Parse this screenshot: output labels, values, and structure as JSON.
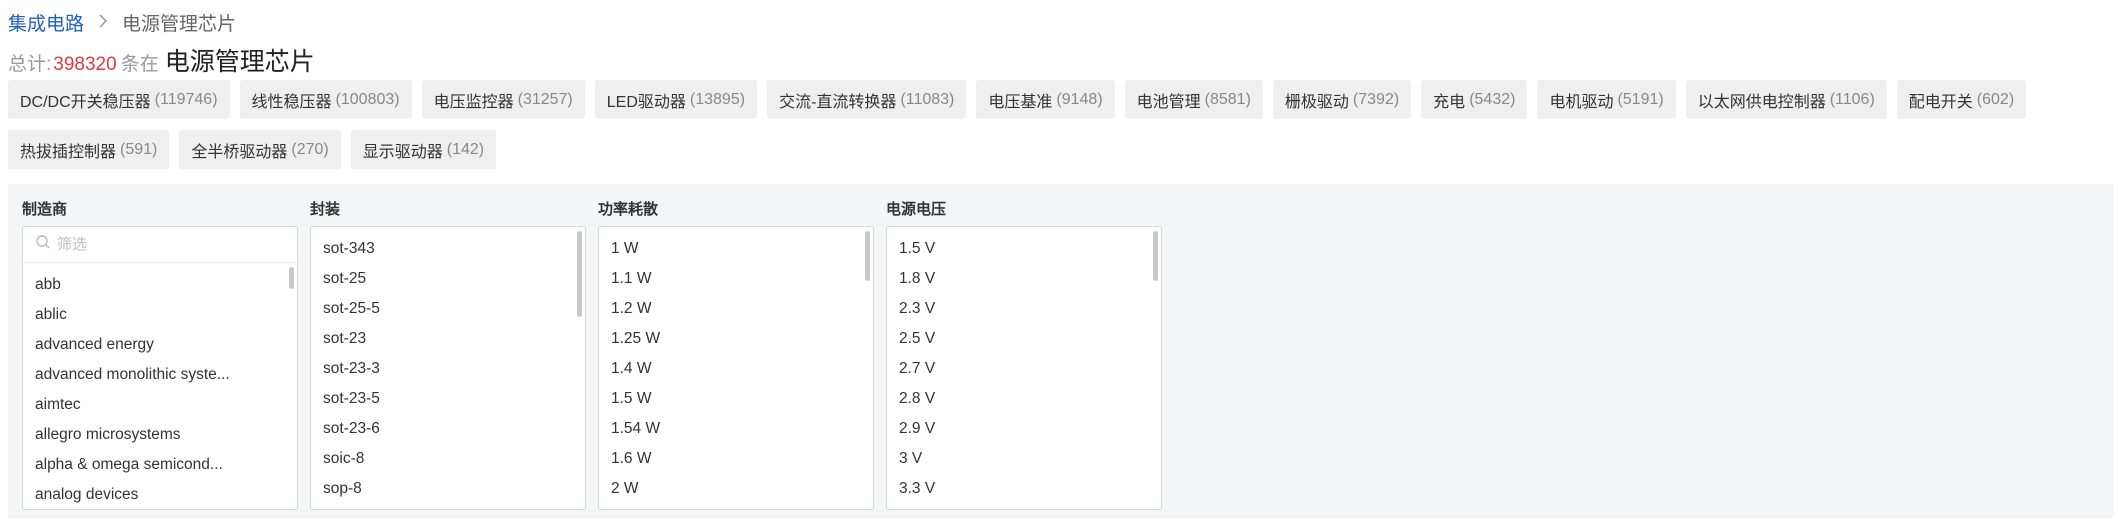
{
  "breadcrumb": {
    "root": "集成电路",
    "current": "电源管理芯片"
  },
  "total": {
    "prefix": "总计:",
    "count": "398320",
    "unit": "条在",
    "category": "电源管理芯片"
  },
  "tags": [
    {
      "label": "DC/DC开关稳压器",
      "count": "(119746)"
    },
    {
      "label": "线性稳压器",
      "count": "(100803)"
    },
    {
      "label": "电压监控器",
      "count": "(31257)"
    },
    {
      "label": "LED驱动器",
      "count": "(13895)"
    },
    {
      "label": "交流-直流转换器",
      "count": "(11083)"
    },
    {
      "label": "电压基准",
      "count": "(9148)"
    },
    {
      "label": "电池管理",
      "count": "(8581)"
    },
    {
      "label": "栅极驱动",
      "count": "(7392)"
    },
    {
      "label": "充电",
      "count": "(5432)"
    },
    {
      "label": "电机驱动",
      "count": "(5191)"
    },
    {
      "label": "以太网供电控制器",
      "count": "(1106)"
    },
    {
      "label": "配电开关",
      "count": "(602)"
    },
    {
      "label": "热拔插控制器",
      "count": "(591)"
    },
    {
      "label": "全半桥驱动器",
      "count": "(270)"
    },
    {
      "label": "显示驱动器",
      "count": "(142)"
    }
  ],
  "filters": {
    "manufacturer": {
      "title": "制造商",
      "search_placeholder": "筛选",
      "items": [
        "abb",
        "ablic",
        "advanced energy",
        "advanced monolithic syste...",
        "aimtec",
        "allegro microsystems",
        "alpha & omega semicond...",
        "analog devices"
      ]
    },
    "package": {
      "title": "封装",
      "items": [
        "sot-343",
        "sot-25",
        "sot-25-5",
        "sot-23",
        "sot-23-3",
        "sot-23-5",
        "sot-23-6",
        "soic-8",
        "sop-8"
      ]
    },
    "power": {
      "title": "功率耗散",
      "items": [
        "1 W",
        "1.1 W",
        "1.2 W",
        "1.25 W",
        "1.4 W",
        "1.5 W",
        "1.54 W",
        "1.6 W",
        "2 W"
      ]
    },
    "voltage": {
      "title": "电源电压",
      "items": [
        "1.5 V",
        "1.8 V",
        "2.3 V",
        "2.5 V",
        "2.7 V",
        "2.8 V",
        "2.9 V",
        "3 V",
        "3.3 V"
      ]
    }
  },
  "colors": {
    "link": "#1f5fbf",
    "count_red": "#e33b3b",
    "tag_bg": "#efefef",
    "panel_bg": "#f4f5f6"
  },
  "icons": {
    "breadcrumb_separator": "chevron-right-icon",
    "search": "search-icon"
  }
}
